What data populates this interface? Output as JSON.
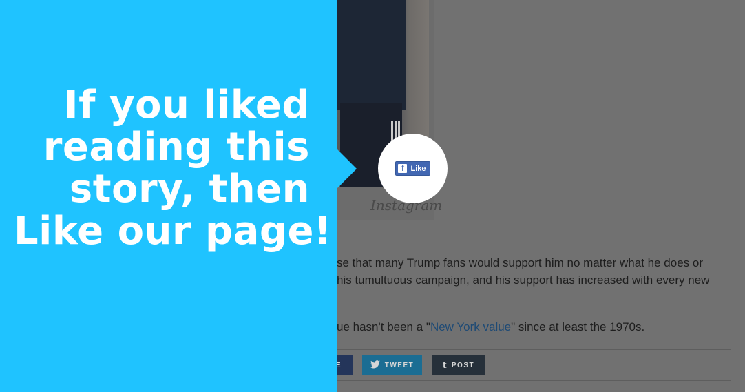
{
  "article": {
    "photo_watermark": "Instagram",
    "paragraph_lines": [
      "se that many Trump fans would support him no matter what he does or",
      "his tumultuous campaign, and his support has increased with every new"
    ],
    "line3_prefix": "ue hasn't been a \"",
    "line3_link": "New York value",
    "line3_suffix": "\" since at least the 1970s."
  },
  "share": {
    "facebook_label": "E",
    "twitter_label": "TWEET",
    "tumblr_label": "POST"
  },
  "overlay": {
    "headline_lines": [
      "If you liked",
      "reading this",
      "story, then",
      "Like our page!"
    ],
    "like_button_label": "Like",
    "colors": {
      "panel": "#1fc3ff",
      "facebook": "#4267b2"
    }
  }
}
